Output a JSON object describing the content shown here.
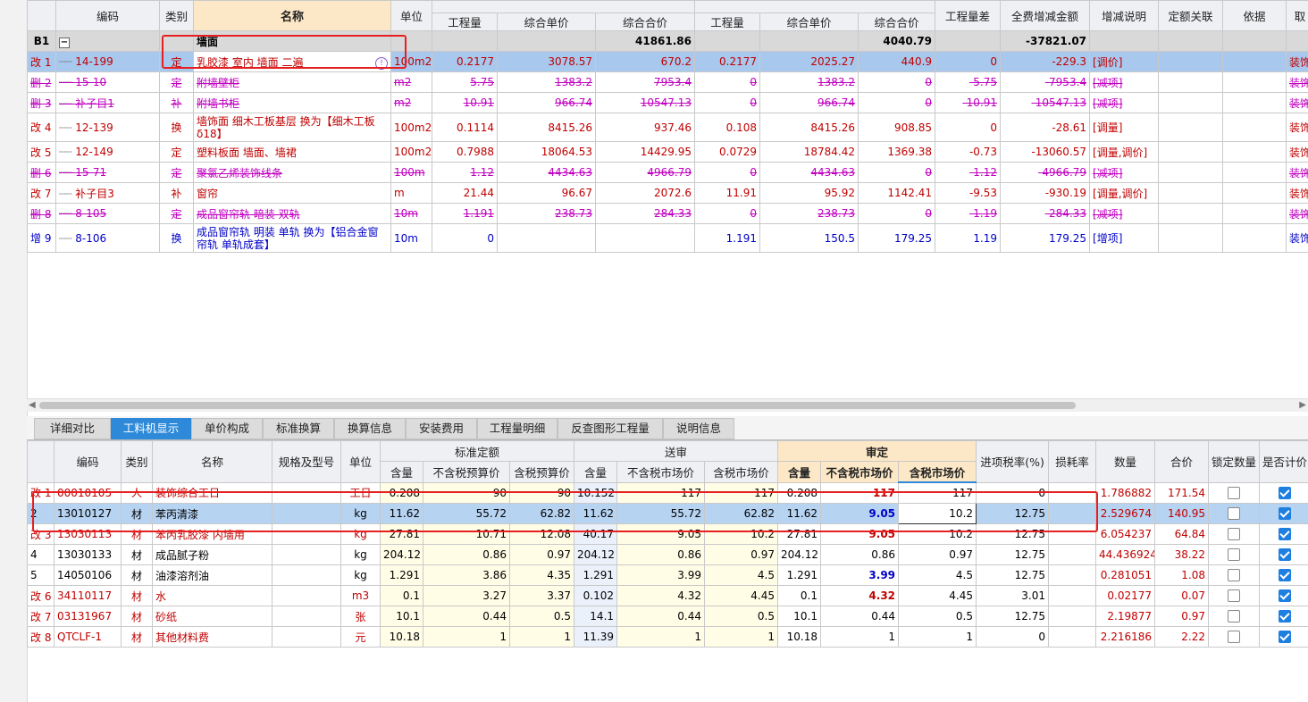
{
  "top": {
    "headers_top": {
      "code": "编码",
      "type": "类别",
      "name": "名称",
      "unit": "单位",
      "qty_diff": "工程量差",
      "total_diff": "全费增减金额",
      "remark": "增减说明",
      "quota_link": "定额关联",
      "basis": "依据",
      "last": "取"
    },
    "headers_sub": {
      "qty1": "工程量",
      "price1": "综合单价",
      "total1": "综合合价",
      "qty2": "工程量",
      "price2": "综合单价",
      "total2": "综合合价"
    },
    "group": {
      "id": "B1",
      "name": "墙面",
      "total1": "41861.86",
      "total2": "4040.79",
      "total_diff": "-37821.07"
    },
    "rows": [
      {
        "status": "改",
        "idx": "1",
        "code": "14-199",
        "type": "定",
        "name": "乳胶漆 室内 墙面 二遍",
        "unit": "100m2",
        "q1": "0.2177",
        "p1": "3078.57",
        "t1": "670.2",
        "q2": "0.2177",
        "p2": "2025.27",
        "t2": "440.9",
        "qd": "0",
        "td": "-229.3",
        "remark": "[调价]",
        "last": "装饰王"
      },
      {
        "status": "删",
        "idx": "2",
        "code": "15-10",
        "type": "定",
        "name": "附墙壁柜",
        "unit": "m2",
        "q1": "5.75",
        "p1": "1383.2",
        "t1": "7953.4",
        "q2": "0",
        "p2": "1383.2",
        "t2": "0",
        "qd": "-5.75",
        "td": "-7953.4",
        "remark": "[减项]",
        "last": "装饰王"
      },
      {
        "status": "删",
        "idx": "3",
        "code": "补子目1",
        "type": "补",
        "name": "附墙书柜",
        "unit": "m2",
        "q1": "10.91",
        "p1": "966.74",
        "t1": "10547.13",
        "q2": "0",
        "p2": "966.74",
        "t2": "0",
        "qd": "-10.91",
        "td": "-10547.13",
        "remark": "[减项]",
        "last": "装饰王"
      },
      {
        "status": "改",
        "idx": "4",
        "code": "12-139",
        "type": "换",
        "name": "墙饰面 细木工板基层  换为【细木工板δ18】",
        "unit": "100m2",
        "q1": "0.1114",
        "p1": "8415.26",
        "t1": "937.46",
        "q2": "0.108",
        "p2": "8415.26",
        "t2": "908.85",
        "qd": "0",
        "td": "-28.61",
        "remark": "[调量]",
        "last": "装饰王"
      },
      {
        "status": "改",
        "idx": "5",
        "code": "12-149",
        "type": "定",
        "name": "塑料板面 墙面、墙裙",
        "unit": "100m2",
        "q1": "0.7988",
        "p1": "18064.53",
        "t1": "14429.95",
        "q2": "0.0729",
        "p2": "18784.42",
        "t2": "1369.38",
        "qd": "-0.73",
        "td": "-13060.57",
        "remark": "[调量,调价]",
        "last": "装饰王"
      },
      {
        "status": "删",
        "idx": "6",
        "code": "15-71",
        "type": "定",
        "name": "聚氯乙烯装饰线条",
        "unit": "100m",
        "q1": "1.12",
        "p1": "4434.63",
        "t1": "4966.79",
        "q2": "0",
        "p2": "4434.63",
        "t2": "0",
        "qd": "-1.12",
        "td": "-4966.79",
        "remark": "[减项]",
        "last": "装饰王"
      },
      {
        "status": "改",
        "idx": "7",
        "code": "补子目3",
        "type": "补",
        "name": "窗帘",
        "unit": "m",
        "q1": "21.44",
        "p1": "96.67",
        "t1": "2072.6",
        "q2": "11.91",
        "p2": "95.92",
        "t2": "1142.41",
        "qd": "-9.53",
        "td": "-930.19",
        "remark": "[调量,调价]",
        "last": "装饰王"
      },
      {
        "status": "删",
        "idx": "8",
        "code": "8-105",
        "type": "定",
        "name": "成品窗帘轨 暗装 双轨",
        "unit": "10m",
        "q1": "1.191",
        "p1": "238.73",
        "t1": "284.33",
        "q2": "0",
        "p2": "238.73",
        "t2": "0",
        "qd": "-1.19",
        "td": "-284.33",
        "remark": "[减项]",
        "last": "装饰王"
      },
      {
        "status": "增",
        "idx": "9",
        "code": "8-106",
        "type": "换",
        "name": "成品窗帘轨 明装 单轨  换为【铝合金窗帘轨 单轨成套】",
        "unit": "10m",
        "q1": "0",
        "p1": "",
        "t1": "",
        "q2": "1.191",
        "p2": "150.5",
        "t2": "179.25",
        "qd": "1.19",
        "td": "179.25",
        "remark": "[增项]",
        "last": "装饰王"
      }
    ]
  },
  "tabs": [
    "详细对比",
    "工料机显示",
    "单价构成",
    "标准换算",
    "换算信息",
    "安装费用",
    "工程量明细",
    "反查图形工程量",
    "说明信息"
  ],
  "active_tab": "工料机显示",
  "bottom": {
    "headers": {
      "code": "编码",
      "type": "类别",
      "name": "名称",
      "spec": "规格及型号",
      "unit": "单位",
      "std": "标准定额",
      "sub": "送审",
      "aud": "审定",
      "tax": "进项税率(%)",
      "loss": "损耗率",
      "qty": "数量",
      "total": "合价",
      "lock": "锁定数量",
      "price_flag": "是否计价"
    },
    "sub_headers": {
      "c1": "含量",
      "c2": "不含税预算价",
      "c3": "含税预算价",
      "c4": "含量",
      "c5": "不含税市场价",
      "c6": "含税市场价",
      "c7": "含量",
      "c8": "不含税市场价",
      "c9": "含税市场价"
    },
    "rows": [
      {
        "status": "改",
        "idx": "1",
        "code": "00010105",
        "type": "人",
        "name": "装饰综合工日",
        "unit": "工日",
        "a": "0.208",
        "b": "90",
        "c": "90",
        "d": "10.152",
        "e": "117",
        "f": "117",
        "g": "0.208",
        "h": "117",
        "i": "117",
        "tax": "0",
        "qty": "1.786882",
        "total": "171.54",
        "lock": false,
        "flag": true
      },
      {
        "status": "",
        "idx": "2",
        "code": "13010127",
        "type": "材",
        "name": "苯丙清漆",
        "unit": "kg",
        "a": "11.62",
        "b": "55.72",
        "c": "62.82",
        "d": "11.62",
        "e": "55.72",
        "f": "62.82",
        "g": "11.62",
        "h": "9.05",
        "i": "10.2",
        "tax": "12.75",
        "qty": "2.529674",
        "total": "140.95",
        "lock": false,
        "flag": true
      },
      {
        "status": "改",
        "idx": "3",
        "code": "13030113",
        "type": "材",
        "name": "苯丙乳胶漆 内墙用",
        "unit": "kg",
        "a": "27.81",
        "b": "10.71",
        "c": "12.08",
        "d": "40.17",
        "e": "9.05",
        "f": "10.2",
        "g": "27.81",
        "h": "9.05",
        "i": "10.2",
        "tax": "12.75",
        "qty": "6.054237",
        "total": "64.84",
        "lock": false,
        "flag": true
      },
      {
        "status": "",
        "idx": "4",
        "code": "13030133",
        "type": "材",
        "name": "成品腻子粉",
        "unit": "kg",
        "a": "204.12",
        "b": "0.86",
        "c": "0.97",
        "d": "204.12",
        "e": "0.86",
        "f": "0.97",
        "g": "204.12",
        "h": "0.86",
        "i": "0.97",
        "tax": "12.75",
        "qty": "44.436924",
        "total": "38.22",
        "lock": false,
        "flag": true
      },
      {
        "status": "",
        "idx": "5",
        "code": "14050106",
        "type": "材",
        "name": "油漆溶剂油",
        "unit": "kg",
        "a": "1.291",
        "b": "3.86",
        "c": "4.35",
        "d": "1.291",
        "e": "3.99",
        "f": "4.5",
        "g": "1.291",
        "h": "3.99",
        "i": "4.5",
        "tax": "12.75",
        "qty": "0.281051",
        "total": "1.08",
        "lock": false,
        "flag": true
      },
      {
        "status": "改",
        "idx": "6",
        "code": "34110117",
        "type": "材",
        "name": "水",
        "unit": "m3",
        "a": "0.1",
        "b": "3.27",
        "c": "3.37",
        "d": "0.102",
        "e": "4.32",
        "f": "4.45",
        "g": "0.1",
        "h": "4.32",
        "i": "4.45",
        "tax": "3.01",
        "qty": "0.02177",
        "total": "0.07",
        "lock": false,
        "flag": true
      },
      {
        "status": "改",
        "idx": "7",
        "code": "03131967",
        "type": "材",
        "name": "砂纸",
        "unit": "张",
        "a": "10.1",
        "b": "0.44",
        "c": "0.5",
        "d": "14.1",
        "e": "0.44",
        "f": "0.5",
        "g": "10.1",
        "h": "0.44",
        "i": "0.5",
        "tax": "12.75",
        "qty": "2.19877",
        "total": "0.97",
        "lock": false,
        "flag": true
      },
      {
        "status": "改",
        "idx": "8",
        "code": "QTCLF-1",
        "type": "材",
        "name": "其他材料费",
        "unit": "元",
        "a": "10.18",
        "b": "1",
        "c": "1",
        "d": "11.39",
        "e": "1",
        "f": "1",
        "g": "10.18",
        "h": "1",
        "i": "1",
        "tax": "0",
        "qty": "2.216186",
        "total": "2.22",
        "lock": false,
        "flag": true
      }
    ]
  }
}
